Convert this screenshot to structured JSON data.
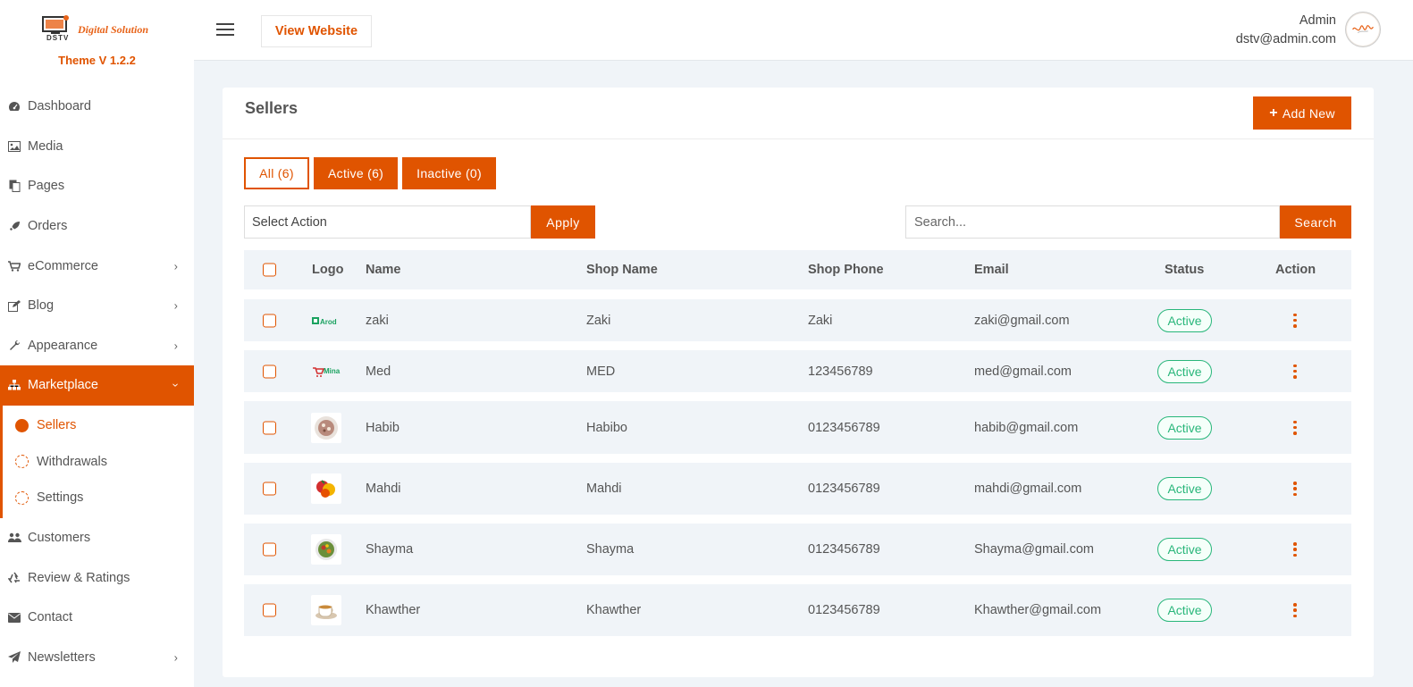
{
  "brand": {
    "name": "Digital Solution",
    "logo_text": "DSTV",
    "version": "Theme V 1.2.2"
  },
  "colors": {
    "accent": "#e05400",
    "status_active": "#28b67a",
    "page_bg": "#f0f4f8"
  },
  "sidebar": {
    "items": [
      {
        "label": "Dashboard",
        "icon": "dashboard-icon"
      },
      {
        "label": "Media",
        "icon": "image-icon"
      },
      {
        "label": "Pages",
        "icon": "copy-icon"
      },
      {
        "label": "Orders",
        "icon": "rocket-icon"
      },
      {
        "label": "eCommerce",
        "icon": "cart-icon"
      },
      {
        "label": "Blog",
        "icon": "edit-icon"
      },
      {
        "label": "Appearance",
        "icon": "wrench-icon"
      },
      {
        "label": "Marketplace",
        "icon": "sitemap-icon"
      },
      {
        "label": "Customers",
        "icon": "users-icon"
      },
      {
        "label": "Review & Ratings",
        "icon": "recycle-icon"
      },
      {
        "label": "Contact",
        "icon": "envelope-icon"
      },
      {
        "label": "Newsletters",
        "icon": "paper-plane-icon"
      }
    ],
    "marketplace_sub": [
      {
        "label": "Sellers"
      },
      {
        "label": "Withdrawals"
      },
      {
        "label": "Settings"
      }
    ]
  },
  "header": {
    "view_website": "View Website",
    "admin_name": "Admin",
    "admin_email": "dstv@admin.com"
  },
  "main": {
    "title": "Sellers",
    "add_new": "Add New",
    "filters": {
      "all": "All (6)",
      "active": "Active (6)",
      "inactive": "Inactive (0)"
    },
    "select_action": "Select Action",
    "apply": "Apply",
    "search_placeholder": "Search...",
    "search_button": "Search",
    "columns": {
      "logo": "Logo",
      "name": "Name",
      "shop_name": "Shop Name",
      "shop_phone": "Shop Phone",
      "email": "Email",
      "status": "Status",
      "action": "Action"
    },
    "rows": [
      {
        "name": "zaki",
        "shop": "Zaki",
        "phone": "Zaki",
        "email": "zaki@gmail.com",
        "status": "Active",
        "logo": "arod-logo"
      },
      {
        "name": "Med",
        "shop": "MED",
        "phone": "123456789",
        "email": "med@gmail.com",
        "status": "Active",
        "logo": "mina-logo"
      },
      {
        "name": "Habib",
        "shop": "Habibo",
        "phone": "0123456789",
        "email": "habib@gmail.com",
        "status": "Active",
        "logo": "salad-bowl"
      },
      {
        "name": "Mahdi",
        "shop": "Mahdi",
        "phone": "0123456789",
        "email": "mahdi@gmail.com",
        "status": "Active",
        "logo": "fruits"
      },
      {
        "name": "Shayma",
        "shop": "Shayma",
        "phone": "0123456789",
        "email": "Shayma@gmail.com",
        "status": "Active",
        "logo": "veggie-plate"
      },
      {
        "name": "Khawther",
        "shop": "Khawther",
        "phone": "0123456789",
        "email": "Khawther@gmail.com",
        "status": "Active",
        "logo": "tea-cup"
      }
    ],
    "logo_texts": {
      "arod": "Arod",
      "mina": "Mina"
    }
  }
}
